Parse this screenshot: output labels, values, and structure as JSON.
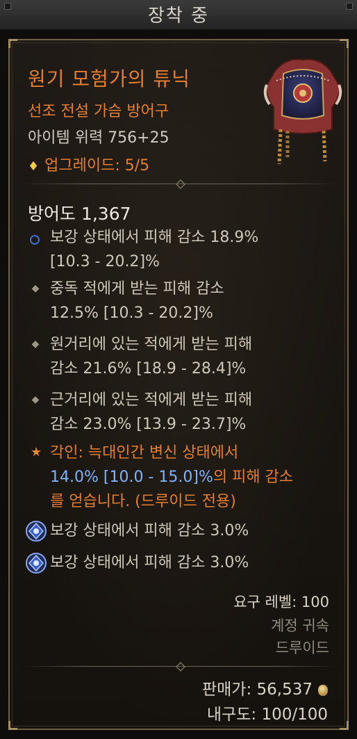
{
  "header": {
    "title": "장착 중"
  },
  "item": {
    "name": "원기 모험가의 튜닉",
    "type": "선조 전설 가슴 방어구",
    "power": "아이템 위력 756+25",
    "upgrade": "업그레이드: 5/5",
    "icon": "tunic-icon"
  },
  "stats": {
    "armor": "방어도 1,367",
    "affixes": [
      {
        "line1": "보강 상태에서 피해 감소 18.9%",
        "line2": "[10.3 - 20.2]%",
        "icon": "tempered-circle-icon"
      },
      {
        "line1": "중독 적에게 받는 피해 감소",
        "line2": "12.5% [10.3 - 20.2]%",
        "icon": "diamond-bullet-icon"
      },
      {
        "line1": "원거리에 있는 적에게 받는 피해",
        "line2": "감소 21.6% [18.9 - 28.4]%",
        "icon": "diamond-bullet-icon"
      },
      {
        "line1": "근거리에 있는 적에게 받는 피해",
        "line2": "감소 23.0% [13.9 - 23.7]%",
        "icon": "diamond-bullet-icon"
      }
    ],
    "aspect": {
      "prefix": "각인: 늑대인간 변신 상태에서",
      "value": "14.0%",
      "range": " [10.0 - 15.0]%",
      "suffix": "의 피해 감소",
      "line3": "를 얻습니다. (드루이드 전용)"
    },
    "sockets": [
      {
        "text": "보강 상태에서 피해 감소 3.0%",
        "icon": "socket-gem-icon"
      },
      {
        "text": "보강 상태에서 피해 감소 3.0%",
        "icon": "socket-gem-icon"
      }
    ]
  },
  "requirements": {
    "level": "요구 레벨: 100",
    "bound": "계정 귀속",
    "class": "드루이드"
  },
  "footer": {
    "sell": "판매가: 56,537",
    "durability": "내구도: 100/100"
  },
  "colors": {
    "legendary": "#e57f2f",
    "blue_value": "#7fb3ff",
    "frame": "#6e5f45"
  }
}
